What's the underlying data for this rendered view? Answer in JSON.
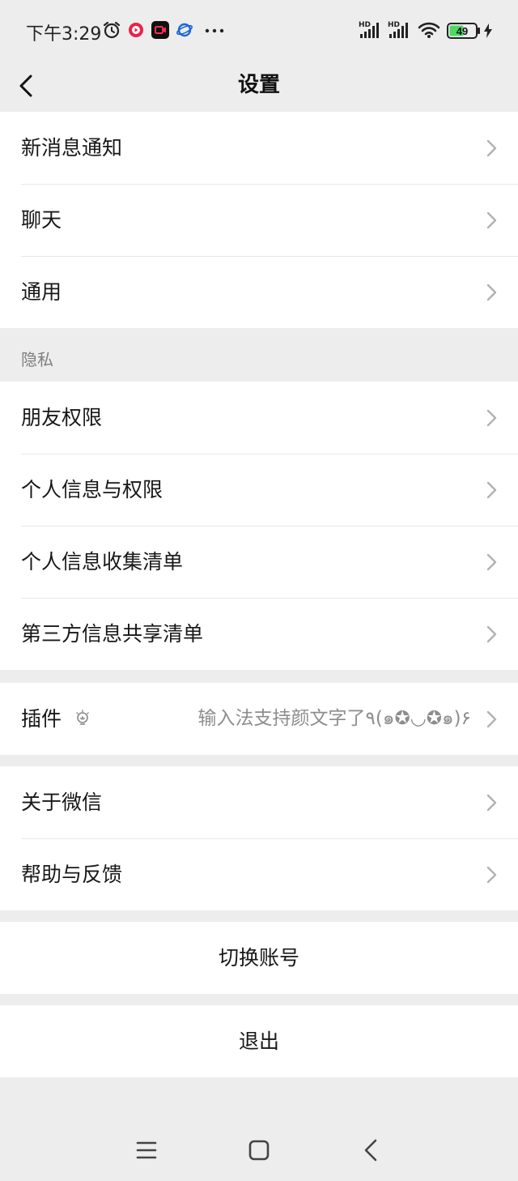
{
  "status_bar": {
    "time": "下午3:29",
    "signal_1_label": "HD",
    "signal_2_label": "HD",
    "battery": "49",
    "icons": [
      "alarm-icon",
      "red-app-icon",
      "video-app-icon",
      "browser-app-icon",
      "more-dots-icon",
      "signal-icon",
      "wifi-icon",
      "battery-icon",
      "charging-icon"
    ]
  },
  "header": {
    "title": "设置"
  },
  "group1": {
    "items": [
      {
        "label": "新消息通知"
      },
      {
        "label": "聊天"
      },
      {
        "label": "通用"
      }
    ]
  },
  "privacy": {
    "section_label": "隐私",
    "items": [
      {
        "label": "朋友权限"
      },
      {
        "label": "个人信息与权限"
      },
      {
        "label": "个人信息收集清单"
      },
      {
        "label": "第三方信息共享清单"
      }
    ]
  },
  "plugins": {
    "label": "插件",
    "hint": "输入法支持颜文字了٩(๑✪◡✪๑)۶",
    "icon": "lightbulb-icon"
  },
  "group4": {
    "items": [
      {
        "label": "关于微信"
      },
      {
        "label": "帮助与反馈"
      }
    ]
  },
  "actions": {
    "switch_account": "切换账号",
    "logout": "退出"
  },
  "nav_bar": {
    "icons": [
      "menu-icon",
      "home-icon",
      "back-icon"
    ]
  },
  "colors": {
    "background": "#ededed",
    "card": "#ffffff",
    "text": "#181818",
    "secondary": "#7f7f7f",
    "battery_fill": "#4cd964"
  }
}
